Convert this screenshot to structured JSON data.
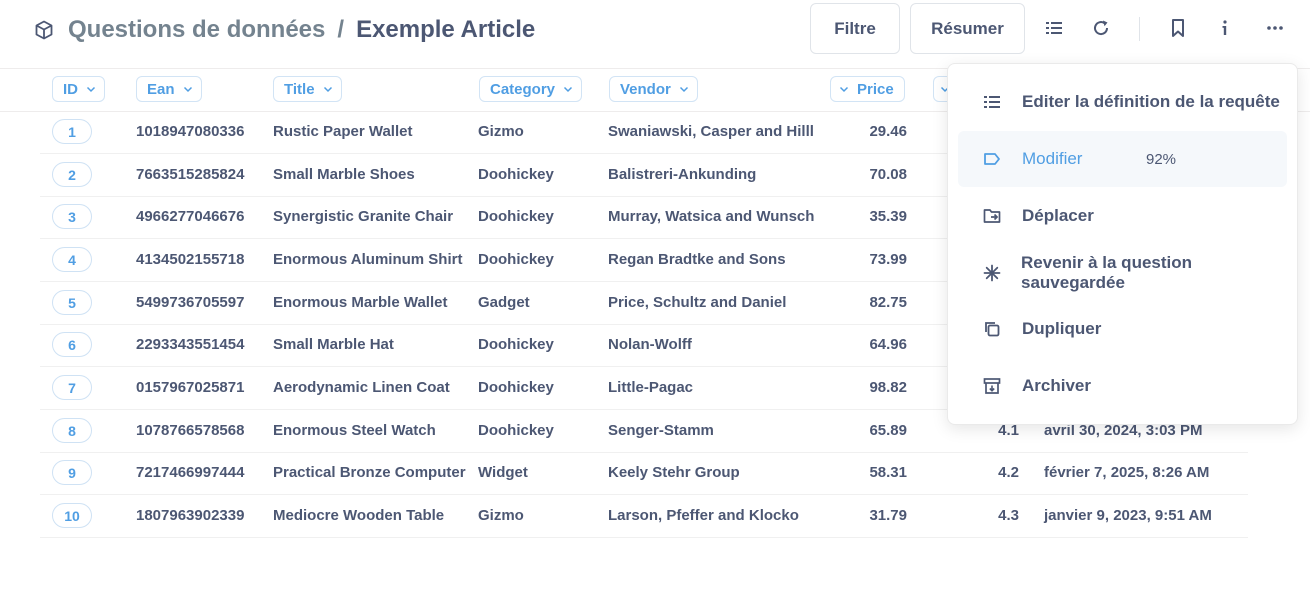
{
  "header": {
    "breadcrumb_parent": "Questions de données",
    "breadcrumb_separator": "/",
    "title": "Exemple Article",
    "filter_label": "Filtre",
    "summarize_label": "Résumer"
  },
  "icons": [
    "cube-icon",
    "list-icon",
    "refresh-icon",
    "bookmark-icon",
    "info-icon",
    "more-icon",
    "chevron-down-icon",
    "edit-icon",
    "tag-icon",
    "move-icon",
    "revert-icon",
    "duplicate-icon",
    "archive-icon"
  ],
  "colors": {
    "accent": "#509ee3",
    "text": "#4c5773",
    "muted": "#74838f"
  },
  "table": {
    "columns": [
      "ID",
      "Ean",
      "Title",
      "Category",
      "Vendor",
      "Price"
    ],
    "rows": [
      {
        "id": "1",
        "ean": "1018947080336",
        "title": "Rustic Paper Wallet",
        "category": "Gizmo",
        "vendor": "Swaniawski, Casper and Hilll",
        "price": "29.46",
        "rating": "",
        "created": ""
      },
      {
        "id": "2",
        "ean": "7663515285824",
        "title": "Small Marble Shoes",
        "category": "Doohickey",
        "vendor": "Balistreri-Ankunding",
        "price": "70.08",
        "rating": "",
        "created": ""
      },
      {
        "id": "3",
        "ean": "4966277046676",
        "title": "Synergistic Granite Chair",
        "category": "Doohickey",
        "vendor": "Murray, Watsica and Wunsch",
        "price": "35.39",
        "rating": "",
        "created": ""
      },
      {
        "id": "4",
        "ean": "4134502155718",
        "title": "Enormous Aluminum Shirt",
        "category": "Doohickey",
        "vendor": "Regan Bradtke and Sons",
        "price": "73.99",
        "rating": "",
        "created": ""
      },
      {
        "id": "5",
        "ean": "5499736705597",
        "title": "Enormous Marble Wallet",
        "category": "Gadget",
        "vendor": "Price, Schultz and Daniel",
        "price": "82.75",
        "rating": "",
        "created": ""
      },
      {
        "id": "6",
        "ean": "2293343551454",
        "title": "Small Marble Hat",
        "category": "Doohickey",
        "vendor": "Nolan-Wolff",
        "price": "64.96",
        "rating": "",
        "created": ""
      },
      {
        "id": "7",
        "ean": "0157967025871",
        "title": "Aerodynamic Linen Coat",
        "category": "Doohickey",
        "vendor": "Little-Pagac",
        "price": "98.82",
        "rating": "",
        "created": ""
      },
      {
        "id": "8",
        "ean": "1078766578568",
        "title": "Enormous Steel Watch",
        "category": "Doohickey",
        "vendor": "Senger-Stamm",
        "price": "65.89",
        "rating": "4.1",
        "created": "avril 30, 2024, 3:03 PM"
      },
      {
        "id": "9",
        "ean": "7217466997444",
        "title": "Practical Bronze Computer",
        "category": "Widget",
        "vendor": "Keely Stehr Group",
        "price": "58.31",
        "rating": "4.2",
        "created": "février 7, 2025, 8:26 AM"
      },
      {
        "id": "10",
        "ean": "1807963902339",
        "title": "Mediocre Wooden Table",
        "category": "Gizmo",
        "vendor": "Larson, Pfeffer and Klocko",
        "price": "31.79",
        "rating": "4.3",
        "created": "janvier 9, 2023, 9:51 AM"
      }
    ]
  },
  "menu": {
    "items": [
      {
        "label": "Editer la définition de la requête",
        "icon": "edit-icon"
      },
      {
        "label": "Modifier",
        "icon": "tag-icon",
        "extra": "92%"
      },
      {
        "label": "Déplacer",
        "icon": "move-icon"
      },
      {
        "label": "Revenir à la question sauvegardée",
        "icon": "revert-icon"
      },
      {
        "label": "Dupliquer",
        "icon": "duplicate-icon"
      },
      {
        "label": "Archiver",
        "icon": "archive-icon"
      }
    ]
  }
}
